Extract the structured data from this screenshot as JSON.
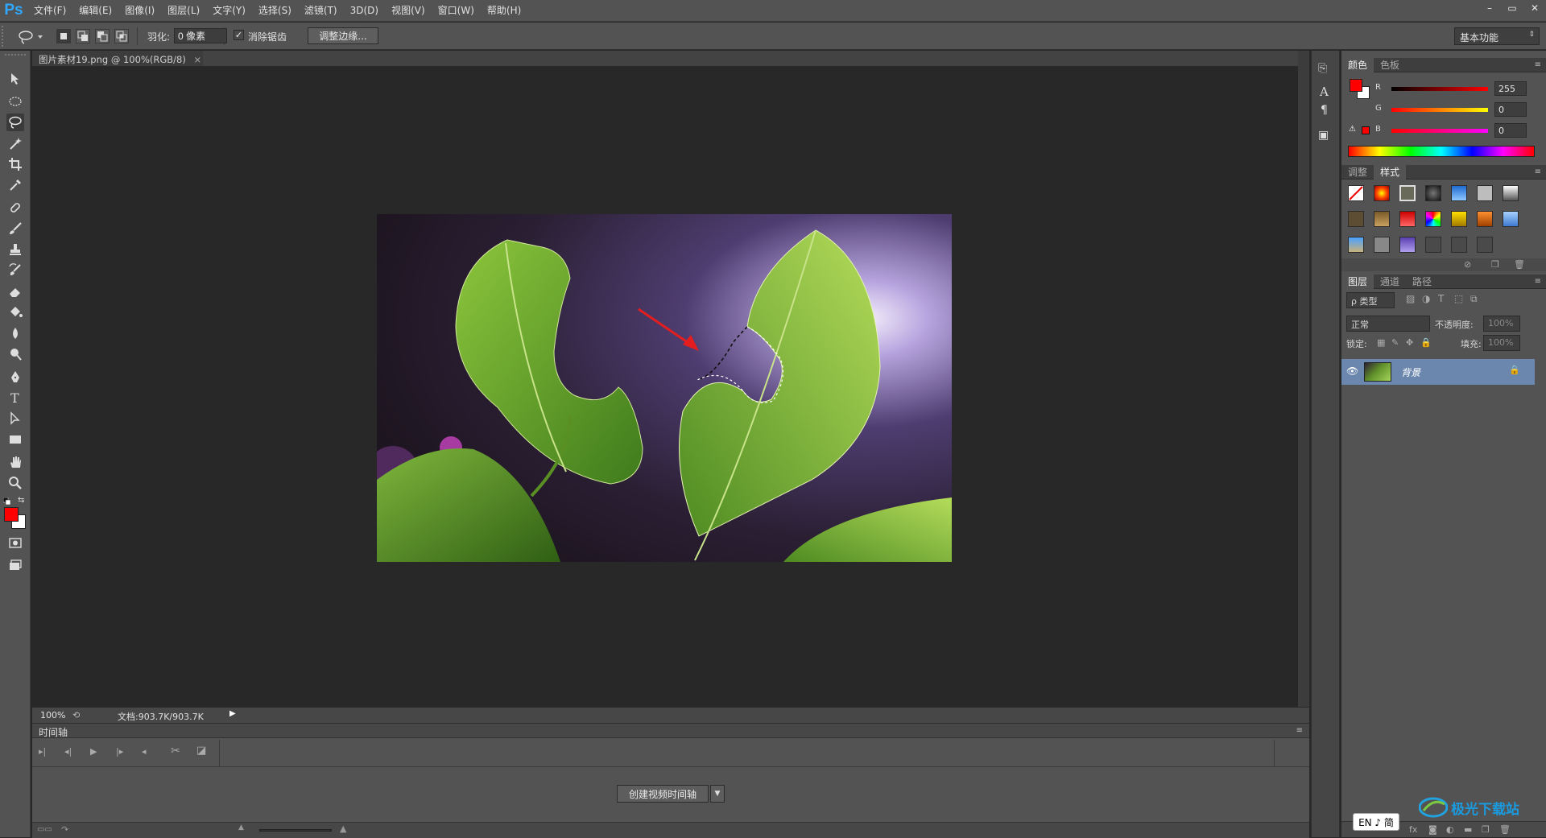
{
  "app": {
    "logo": "Ps",
    "window_controls": [
      "–",
      "▭",
      "✕"
    ]
  },
  "menu": [
    "文件(F)",
    "编辑(E)",
    "图像(I)",
    "图层(L)",
    "文字(Y)",
    "选择(S)",
    "滤镜(T)",
    "3D(D)",
    "视图(V)",
    "窗口(W)",
    "帮助(H)"
  ],
  "options": {
    "feather_label": "羽化:",
    "feather_value": "0 像素",
    "antialias_label": "消除锯齿",
    "antialias_checked": true,
    "refine_edge": "调整边缘...",
    "workspace": "基本功能"
  },
  "document": {
    "tab_title": "图片素材19.png @ 100%(RGB/8)",
    "tab_close": "×",
    "zoom": "100%",
    "doc_info": "文档:903.7K/903.7K"
  },
  "timeline": {
    "title": "时间轴",
    "create_button": "创建视频时间轴"
  },
  "color_panel": {
    "tabs": [
      "颜色",
      "色板"
    ],
    "active_tab": 0,
    "channels": [
      {
        "label": "R",
        "value": "255"
      },
      {
        "label": "G",
        "value": "0"
      },
      {
        "label": "B",
        "value": "0"
      }
    ],
    "foreground": "#ff0000",
    "background": "#ffffff"
  },
  "styles_panel": {
    "tabs": [
      "调整",
      "样式"
    ],
    "active_tab": 1
  },
  "layers_panel": {
    "tabs": [
      "图层",
      "通道",
      "路径"
    ],
    "active_tab": 0,
    "filter_label": "ρ 类型",
    "blend_mode": "正常",
    "opacity_label": "不透明度:",
    "opacity_value": "100%",
    "lock_label": "锁定:",
    "fill_label": "填充:",
    "fill_value": "100%",
    "layers": [
      {
        "name": "背景",
        "visible": true,
        "locked": true
      }
    ]
  },
  "ime": {
    "label": "EN ♪ 简"
  },
  "watermark": {
    "text": "极光下载站"
  }
}
